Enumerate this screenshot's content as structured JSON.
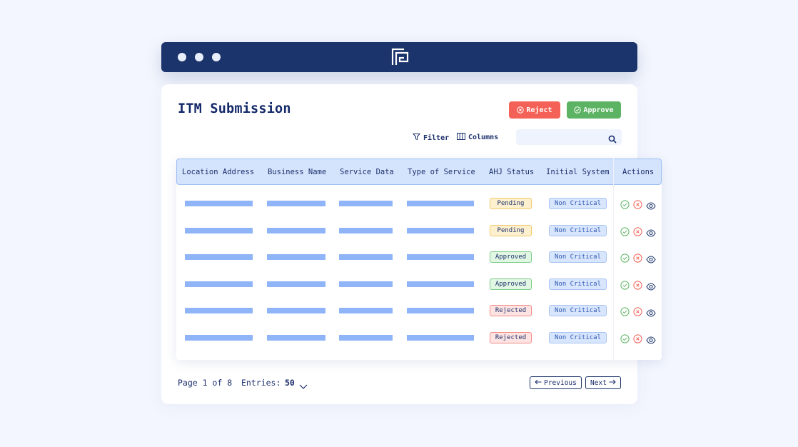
{
  "window": {
    "controls": [
      "dot",
      "dot",
      "dot"
    ],
    "logo_icon": "app-logo-icon"
  },
  "page": {
    "title": "ITM Submission"
  },
  "actions": {
    "reject_label": "Reject",
    "approve_label": "Approve"
  },
  "toolbar": {
    "filter_label": "Filter",
    "columns_label": "Columns",
    "search_placeholder": ""
  },
  "table": {
    "columns": [
      "Location Address",
      "Business Name",
      "Service Data",
      "Type of Service",
      "AHJ Status",
      "Initial System",
      "Actions"
    ],
    "rows": [
      {
        "ahj_status": "Pending",
        "status_kind": "pending",
        "initial_system": "Non Critical"
      },
      {
        "ahj_status": "Pending",
        "status_kind": "pending",
        "initial_system": "Non Critical"
      },
      {
        "ahj_status": "Approved",
        "status_kind": "approved",
        "initial_system": "Non Critical"
      },
      {
        "ahj_status": "Approved",
        "status_kind": "approved",
        "initial_system": "Non Critical"
      },
      {
        "ahj_status": "Rejected",
        "status_kind": "rejected",
        "initial_system": "Non Critical"
      },
      {
        "ahj_status": "Rejected",
        "status_kind": "rejected",
        "initial_system": "Non Critical"
      }
    ],
    "row_actions": [
      "approve-icon",
      "reject-icon",
      "view-icon"
    ]
  },
  "pagination": {
    "page_text": "Page 1 of 8",
    "entries_label": "Entries:",
    "entries_value": "50",
    "prev_label": "Previous",
    "next_label": "Next"
  },
  "colors": {
    "navy": "#1b346b",
    "reject": "#f46156",
    "approve": "#5cb363",
    "placeholder_bar": "#8fb4f7",
    "header_bg": "#d5e4fd"
  }
}
